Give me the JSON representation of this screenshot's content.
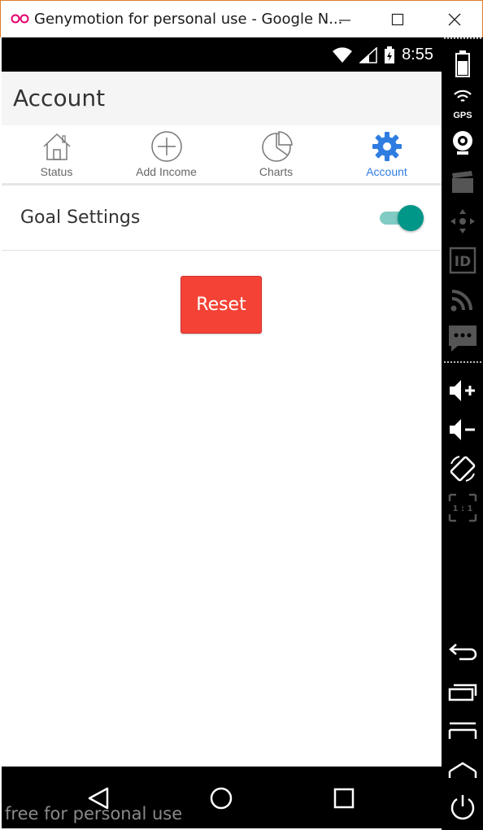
{
  "window": {
    "title": "Genymotion for personal use - Google N...",
    "controls": [
      "minimize",
      "maximize",
      "close"
    ]
  },
  "statusbar": {
    "time": "8:55"
  },
  "appbar": {
    "title": "Account"
  },
  "tabs": [
    {
      "label": "Status",
      "icon": "home-icon",
      "active": false
    },
    {
      "label": "Add Income",
      "icon": "plus-circle-icon",
      "active": false
    },
    {
      "label": "Charts",
      "icon": "pie-chart-icon",
      "active": false
    },
    {
      "label": "Account",
      "icon": "gear-icon",
      "active": true
    }
  ],
  "settings": {
    "goal_label": "Goal Settings",
    "goal_enabled": true
  },
  "actions": {
    "reset_label": "Reset"
  },
  "watermark": "free for personal use",
  "toolbar": {
    "gps_label": "GPS",
    "scale_label": "1 : 1"
  },
  "colors": {
    "accent_blue": "#2f7de1",
    "switch_on": "#009688",
    "reset_red": "#f44336"
  }
}
